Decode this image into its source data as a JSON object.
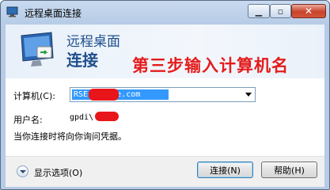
{
  "window": {
    "title": "远程桌面连接"
  },
  "header": {
    "line1": "远程桌面",
    "line2": "连接",
    "annotation": "第三步输入计算机名"
  },
  "form": {
    "computer_label": "计算机(C):",
    "computer_value": "RSE gpdiwe.com",
    "user_label": "用户名:",
    "user_value": "gpdi\\",
    "note": "当你连接时将向你询问凭据。"
  },
  "footer": {
    "options_label": "显示选项(O)",
    "connect_label": "连接(N)",
    "help_label": "帮助(H)"
  },
  "colors": {
    "accent": "#1e4e8c",
    "annotation": "#e51b1b",
    "selection": "#3399ff"
  },
  "icons": [
    "remote-desktop-icon",
    "minimize-icon",
    "maximize-icon",
    "close-icon",
    "dropdown-arrow-icon",
    "options-expand-icon"
  ]
}
